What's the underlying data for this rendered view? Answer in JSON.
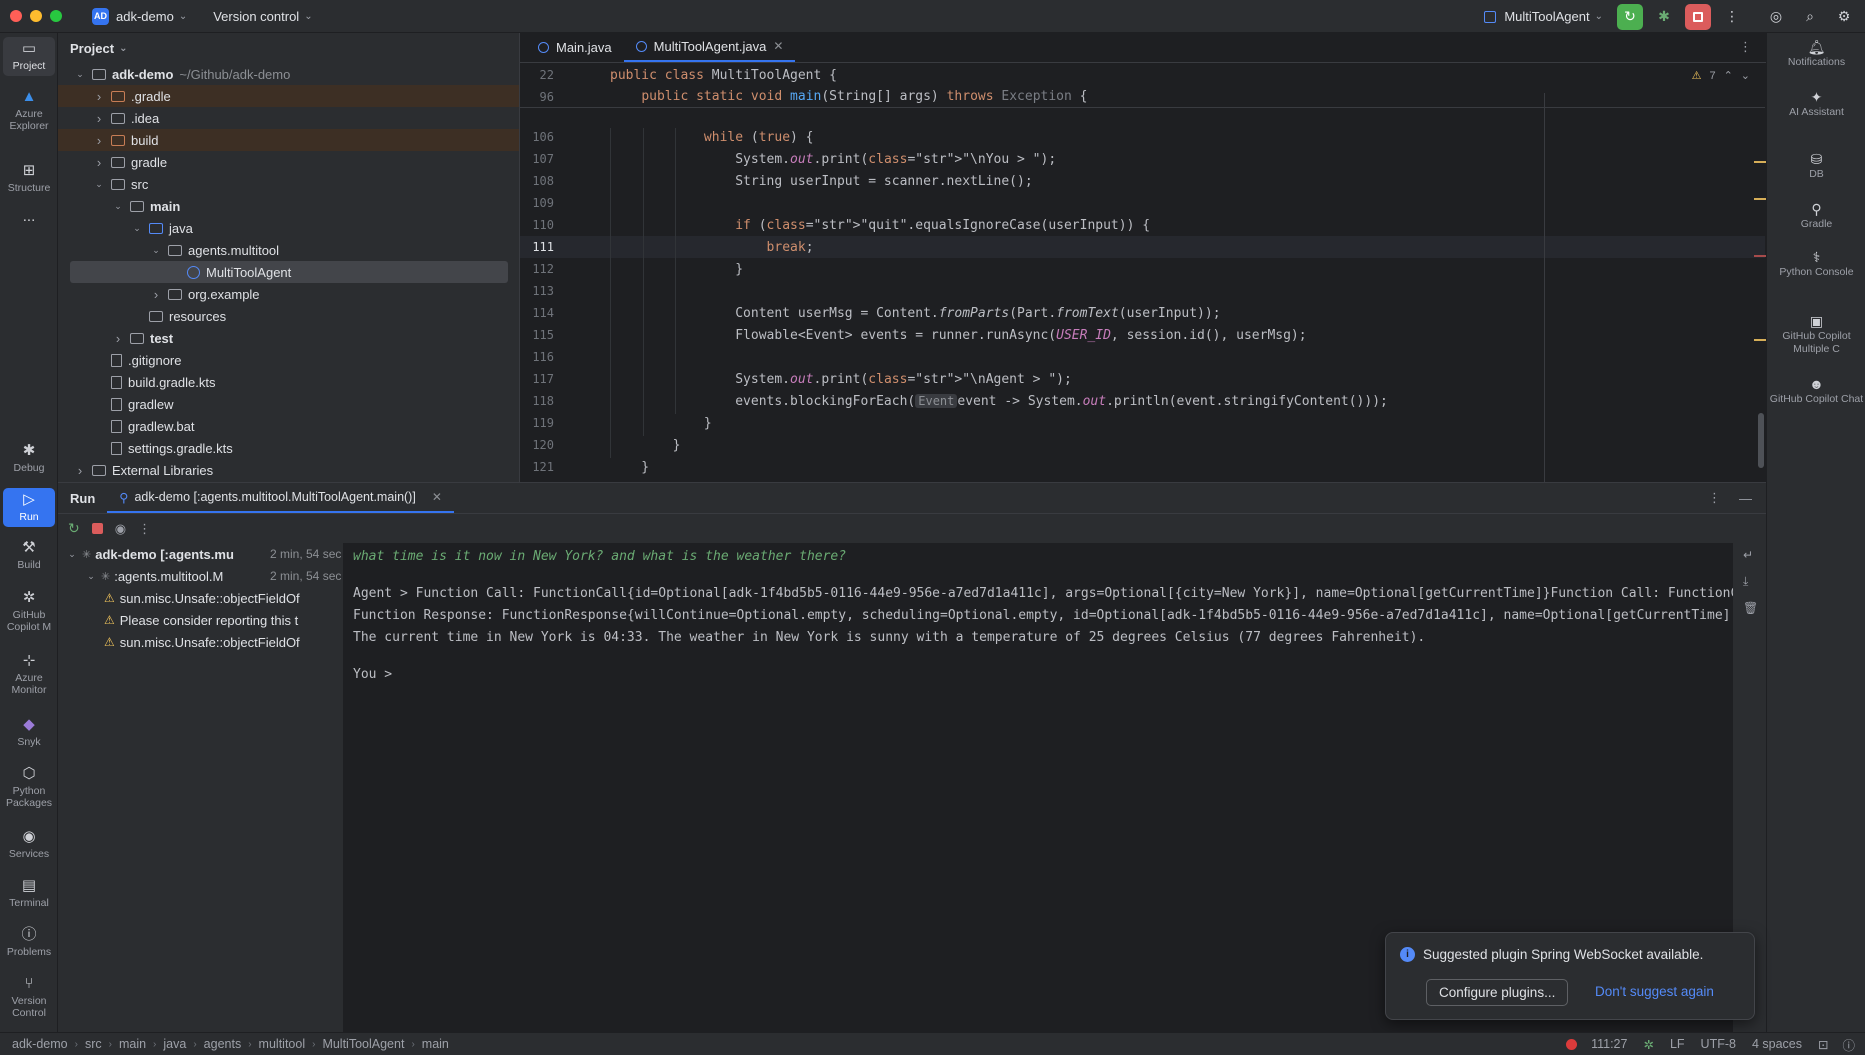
{
  "titlebar": {
    "project_badge": "AD",
    "project_name": "adk-demo",
    "vcs": "Version control",
    "run_config": "MultiToolAgent"
  },
  "left_tools": [
    {
      "label": "Project",
      "icon": "folder-icon"
    },
    {
      "label": "Azure Explorer",
      "icon": "azure-icon"
    },
    {
      "label": "Structure",
      "icon": "structure-icon"
    },
    {
      "label": "...",
      "icon": "more-icon"
    },
    {
      "label": "Debug",
      "icon": "bug-icon"
    },
    {
      "label": "Run",
      "icon": "play-icon"
    },
    {
      "label": "Build",
      "icon": "hammer-icon"
    },
    {
      "label": "GitHub Copilot M",
      "icon": "copilot-icon"
    },
    {
      "label": "Azure Monitor",
      "icon": "monitor-icon"
    },
    {
      "label": "Snyk",
      "icon": "snyk-icon"
    },
    {
      "label": "Python Packages",
      "icon": "packages-icon"
    },
    {
      "label": "Services",
      "icon": "services-icon"
    },
    {
      "label": "Terminal",
      "icon": "terminal-icon"
    },
    {
      "label": "Problems",
      "icon": "problems-icon"
    },
    {
      "label": "Version Control",
      "icon": "vcs-icon"
    }
  ],
  "right_tools": [
    {
      "label": "Notifications",
      "icon": "bell-icon"
    },
    {
      "label": "AI Assistant",
      "icon": "ai-icon"
    },
    {
      "label": "DB",
      "icon": "database-icon"
    },
    {
      "label": "Gradle",
      "icon": "gradle-icon"
    },
    {
      "label": "Python Console",
      "icon": "python-icon"
    },
    {
      "label": "GitHub Copilot Multiple C",
      "icon": "copilot-icon"
    },
    {
      "label": "GitHub Copilot Chat",
      "icon": "copilot-chat-icon"
    }
  ],
  "project": {
    "header": "Project",
    "tree": [
      {
        "name": "adk-demo",
        "extra": "~/Github/adk-demo",
        "depth": 0,
        "type": "folder",
        "expanded": true,
        "bold": true
      },
      {
        "name": ".gradle",
        "depth": 1,
        "type": "folder-orange",
        "expanded": false
      },
      {
        "name": ".idea",
        "depth": 1,
        "type": "folder",
        "expanded": false
      },
      {
        "name": "build",
        "depth": 1,
        "type": "folder-orange",
        "expanded": false
      },
      {
        "name": "gradle",
        "depth": 1,
        "type": "folder",
        "expanded": false
      },
      {
        "name": "src",
        "depth": 1,
        "type": "folder",
        "expanded": true
      },
      {
        "name": "main",
        "depth": 2,
        "type": "folder",
        "expanded": true,
        "bold": true
      },
      {
        "name": "java",
        "depth": 3,
        "type": "folder-blue",
        "expanded": true
      },
      {
        "name": "agents.multitool",
        "depth": 4,
        "type": "package",
        "expanded": true
      },
      {
        "name": "MultiToolAgent",
        "depth": 5,
        "type": "class",
        "selected": true
      },
      {
        "name": "org.example",
        "depth": 4,
        "type": "package",
        "expanded": false
      },
      {
        "name": "resources",
        "depth": 3,
        "type": "folder"
      },
      {
        "name": "test",
        "depth": 2,
        "type": "folder",
        "expanded": false,
        "bold": true
      },
      {
        "name": ".gitignore",
        "depth": 1,
        "type": "file"
      },
      {
        "name": "build.gradle.kts",
        "depth": 1,
        "type": "file"
      },
      {
        "name": "gradlew",
        "depth": 1,
        "type": "file"
      },
      {
        "name": "gradlew.bat",
        "depth": 1,
        "type": "file"
      },
      {
        "name": "settings.gradle.kts",
        "depth": 1,
        "type": "file"
      },
      {
        "name": "External Libraries",
        "depth": 0,
        "type": "library",
        "expanded": false
      }
    ]
  },
  "editor": {
    "tabs": [
      {
        "label": "Main.java",
        "active": false
      },
      {
        "label": "MultiToolAgent.java",
        "active": true
      }
    ],
    "warnings": "7",
    "sticky": [
      {
        "ln": "22",
        "code": "public class MultiToolAgent {"
      },
      {
        "ln": "96",
        "code": "    public static void main(String[] args) throws Exception {"
      }
    ],
    "lines": [
      {
        "ln": "106",
        "code": "            while (true) {"
      },
      {
        "ln": "107",
        "code": "                System.out.print(\"\\nYou > \");"
      },
      {
        "ln": "108",
        "code": "                String userInput = scanner.nextLine();"
      },
      {
        "ln": "109",
        "code": ""
      },
      {
        "ln": "110",
        "code": "                if (\"quit\".equalsIgnoreCase(userInput)) {"
      },
      {
        "ln": "111",
        "code": "                    break;"
      },
      {
        "ln": "112",
        "code": "                }"
      },
      {
        "ln": "113",
        "code": ""
      },
      {
        "ln": "114",
        "code": "                Content userMsg = Content.fromParts(Part.fromText(userInput));"
      },
      {
        "ln": "115",
        "code": "                Flowable<Event> events = runner.runAsync(USER_ID, session.id(), userMsg);"
      },
      {
        "ln": "116",
        "code": ""
      },
      {
        "ln": "117",
        "code": "                System.out.print(\"\\nAgent > \");"
      },
      {
        "ln": "118",
        "code": "                events.blockingForEach( Event event -> System.out.println(event.stringifyContent()));"
      },
      {
        "ln": "119",
        "code": "            }"
      },
      {
        "ln": "120",
        "code": "        }"
      },
      {
        "ln": "121",
        "code": "    }"
      }
    ]
  },
  "run": {
    "title": "Run",
    "tab": "adk-demo [:agents.multitool.MultiToolAgent.main()]",
    "tree": [
      {
        "label": "adk-demo [:agents.mu",
        "time": "2 min, 54 sec",
        "depth": 0,
        "bold": true
      },
      {
        "label": ":agents.multitool.M",
        "time": "2 min, 54 sec",
        "depth": 1
      },
      {
        "label": "sun.misc.Unsafe::objectFieldOf",
        "depth": 2,
        "warn": true
      },
      {
        "label": "Please consider reporting this t",
        "depth": 2,
        "warn": true
      },
      {
        "label": "sun.misc.Unsafe::objectFieldOf",
        "depth": 2,
        "warn": true
      }
    ],
    "console": {
      "input": "what time is it now in New York? and what is the weather there?",
      "line1": "Agent > Function Call: FunctionCall{id=Optional[adk-1f4bd5b5-0116-44e9-956e-a7ed7d1a411c], args=Optional[{city=New York}], name=Optional[getCurrentTime]}Function Call: FunctionC",
      "line2": "Function Response: FunctionResponse{willContinue=Optional.empty, scheduling=Optional.empty, id=Optional[adk-1f4bd5b5-0116-44e9-956e-a7ed7d1a411c], name=Optional[getCurrentTime],",
      "line3": "The current time in New York is 04:33. The weather in New York is sunny with a temperature of 25 degrees Celsius (77 degrees Fahrenheit).",
      "prompt": "You >"
    }
  },
  "notification": {
    "text": "Suggested plugin Spring WebSocket available.",
    "configure": "Configure plugins...",
    "dismiss": "Don't suggest again"
  },
  "statusbar": {
    "breadcrumb": [
      "adk-demo",
      "src",
      "main",
      "java",
      "agents",
      "multitool",
      "MultiToolAgent",
      "main"
    ],
    "position": "111:27",
    "line_sep": "LF",
    "encoding": "UTF-8",
    "indent": "4 spaces"
  },
  "colors": {
    "accent": "#3574f0",
    "run_green": "#4caf50",
    "stop_red": "#db5c5c"
  }
}
